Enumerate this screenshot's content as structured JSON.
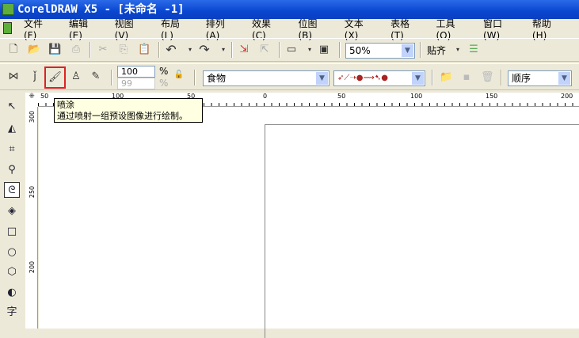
{
  "title": "CorelDRAW X5 - [未命名 -1]",
  "menu": [
    "文件(F)",
    "编辑(E)",
    "视图(V)",
    "布局(L)",
    "排列(A)",
    "效果(C)",
    "位图(B)",
    "文本(X)",
    "表格(T)",
    "工具(O)",
    "窗口(W)",
    "帮助(H)"
  ],
  "toolbar": {
    "zoom": "50%",
    "snap": "贴齐"
  },
  "property_bar": {
    "size": "100",
    "size2": "99",
    "percent": "%",
    "category": "食物",
    "order": "顺序"
  },
  "tooltip": {
    "title": "喷涂",
    "text": "通过喷射一组预设图像进行绘制。"
  },
  "ruler_top": [
    "50",
    "100",
    "50",
    "0",
    "50",
    "100",
    "150",
    "200"
  ],
  "ruler_left": [
    "300",
    "250",
    "200"
  ],
  "toolbox": {
    "text_tool": "字"
  }
}
